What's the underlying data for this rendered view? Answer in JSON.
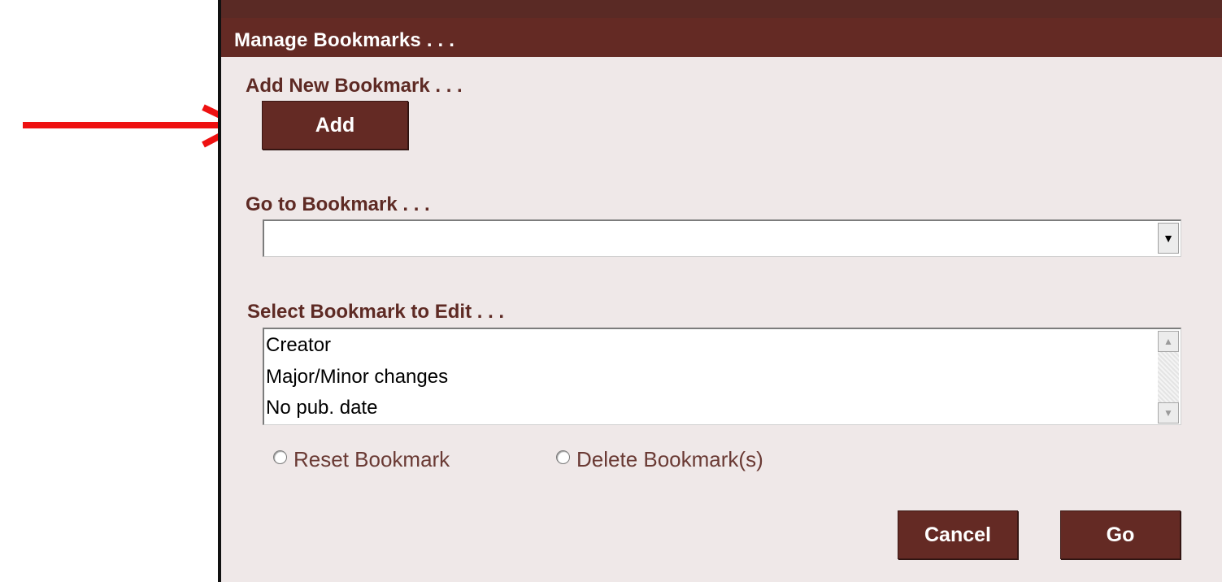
{
  "dialog": {
    "title": "Manage Bookmarks . . ."
  },
  "add_section": {
    "label": "Add New Bookmark . . .",
    "add_button": "Add"
  },
  "goto_section": {
    "label": "Go to Bookmark . . .",
    "selected_value": "",
    "arrow_icon": "dropdown-arrow"
  },
  "edit_section": {
    "label": "Select Bookmark to Edit . . .",
    "items": [
      {
        "label": "Creator"
      },
      {
        "label": "Major/Minor changes"
      },
      {
        "label": "No pub. date"
      }
    ]
  },
  "options": {
    "reset": "Reset Bookmark",
    "delete": "Delete Bookmark(s)"
  },
  "footer": {
    "cancel": "Cancel",
    "go": "Go"
  },
  "colors": {
    "titlebar": "#642a24",
    "dialog_bg": "#efe8e8",
    "label_text": "#5e2a24",
    "annotation_arrow": "#ee1111"
  }
}
